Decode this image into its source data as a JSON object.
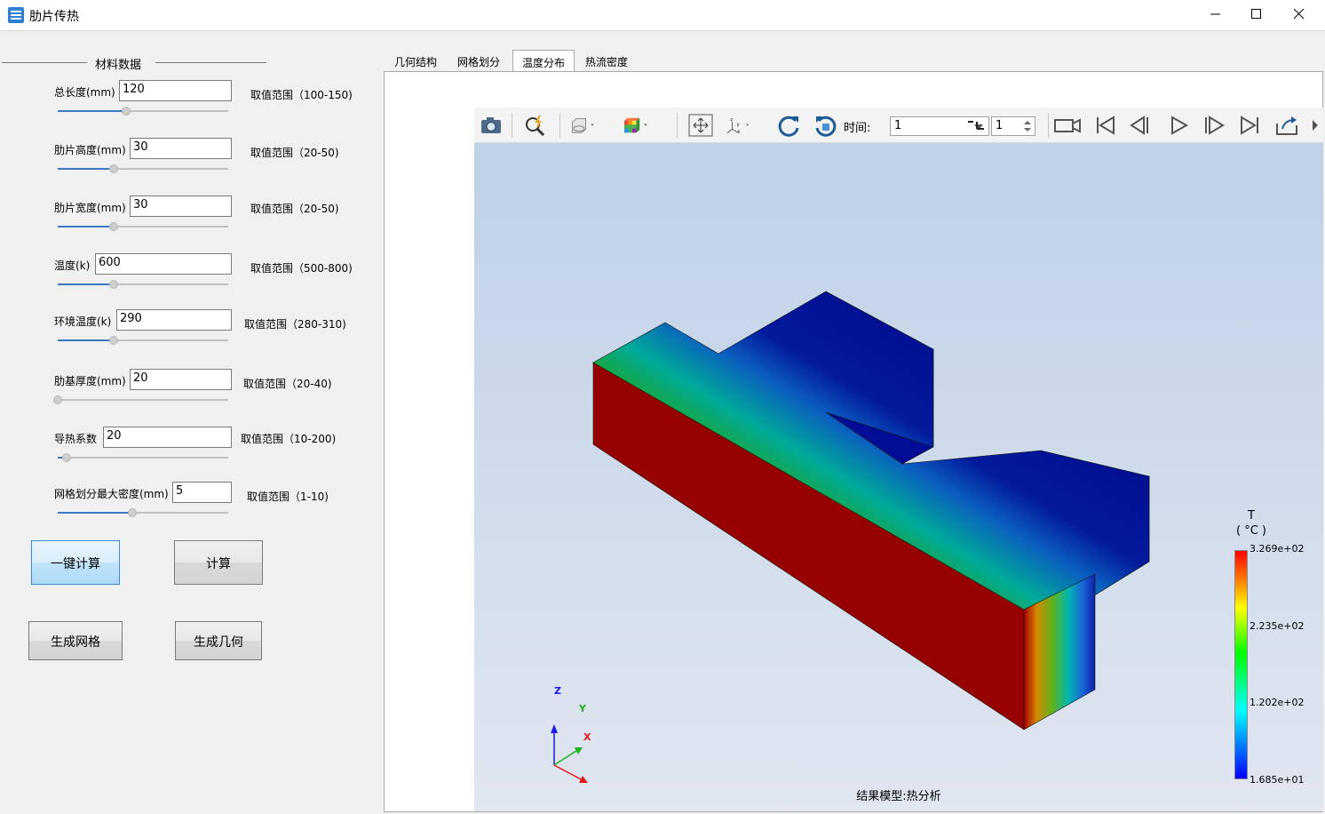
{
  "window": {
    "title": "肋片传热"
  },
  "materials": {
    "group_title": "材料数据",
    "params": [
      {
        "label": "总长度(mm)",
        "value": "120",
        "range": "取值范围（100-150)",
        "slider_fraction": 0.4
      },
      {
        "label": "肋片高度(mm)",
        "value": "30",
        "range": "取值范围（20-50)",
        "slider_fraction": 0.33
      },
      {
        "label": "肋片宽度(mm)",
        "value": "30",
        "range": "取值范围（20-50)",
        "slider_fraction": 0.33
      },
      {
        "label": "温度(k)",
        "value": "600",
        "range": "取值范围（500-800)",
        "slider_fraction": 0.33
      },
      {
        "label": "环境温度(k)",
        "value": "290",
        "range": "取值范围（280-310)",
        "slider_fraction": 0.33
      },
      {
        "label": "肋基厚度(mm)",
        "value": "20",
        "range": "取值范围（20-40)",
        "slider_fraction": 0.0
      },
      {
        "label": "导热系数",
        "value": "20",
        "range": "取值范围（10-200)",
        "slider_fraction": 0.05
      },
      {
        "label": "网格划分最大密度(mm)",
        "value": "5",
        "range": "取值范围（1-10)",
        "slider_fraction": 0.44
      }
    ]
  },
  "buttons": {
    "one_click_compute": "一键计算",
    "compute": "计算",
    "generate_mesh": "生成网格",
    "generate_geometry": "生成几何"
  },
  "tabs": [
    {
      "label": "几何结构",
      "active": false
    },
    {
      "label": "网格划分",
      "active": false
    },
    {
      "label": "温度分布",
      "active": true
    },
    {
      "label": "热流密度",
      "active": false
    }
  ],
  "toolbar": {
    "time_label": "时间:",
    "time_value": "1",
    "step_value": "1",
    "icons": [
      "camera-icon",
      "zoom-icon",
      "display-mode-icon",
      "color-cube-icon",
      "fit-view-icon",
      "axes-icon",
      "rotate-cw-icon",
      "rotate-ccw-icon",
      "record-icon",
      "first-frame-icon",
      "prev-frame-icon",
      "play-icon",
      "next-frame-icon",
      "last-frame-icon",
      "export-icon"
    ]
  },
  "viewer": {
    "caption": "结果模型:热分析",
    "axes": {
      "x": "X",
      "y": "Y",
      "z": "Z"
    }
  },
  "legend": {
    "variable": "T",
    "unit": "( °C )",
    "values": [
      "3.269e+02",
      "2.235e+02",
      "1.202e+02",
      "1.685e+01"
    ],
    "colors": {
      "hot": "#ff0000",
      "cold": "#0000ff"
    }
  }
}
